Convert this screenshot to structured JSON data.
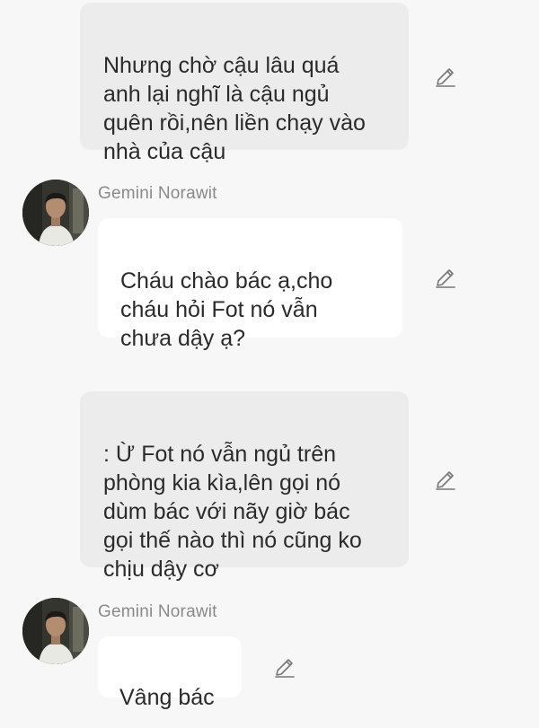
{
  "messages": [
    {
      "type": "narration",
      "text": "Nhưng chờ cậu lâu quá\nanh lại nghĩ là cậu ngủ\nquên rồi,nên liền chạy vào\nnhà của cậu",
      "action_icon": "pencil-edit-icon"
    },
    {
      "type": "character",
      "sender": "Gemini Norawit",
      "avatar": "character-avatar",
      "text": "Cháu chào bác ạ,cho\ncháu hỏi Fot nó vẫn\nchưa dậy ạ?",
      "action_icon": "pencil-edit-icon"
    },
    {
      "type": "narration",
      "text": ": Ừ Fot nó vẫn ngủ trên\nphòng kia kìa,lên gọi nó\ndùm bác với nãy giờ bác\ngọi thế nào thì nó cũng ko\nchịu dậy cơ",
      "action_icon": "pencil-edit-icon"
    },
    {
      "type": "character",
      "sender": "Gemini Norawit",
      "avatar": "character-avatar",
      "text": "Vâng bác",
      "action_icon": "pencil-edit-icon"
    }
  ],
  "colors": {
    "background": "#f7f7f7",
    "narration_bubble": "#ececec",
    "character_bubble": "#ffffff",
    "sender_name": "#8a8a8a",
    "text": "#2b2b2b",
    "icon": "#777777"
  }
}
